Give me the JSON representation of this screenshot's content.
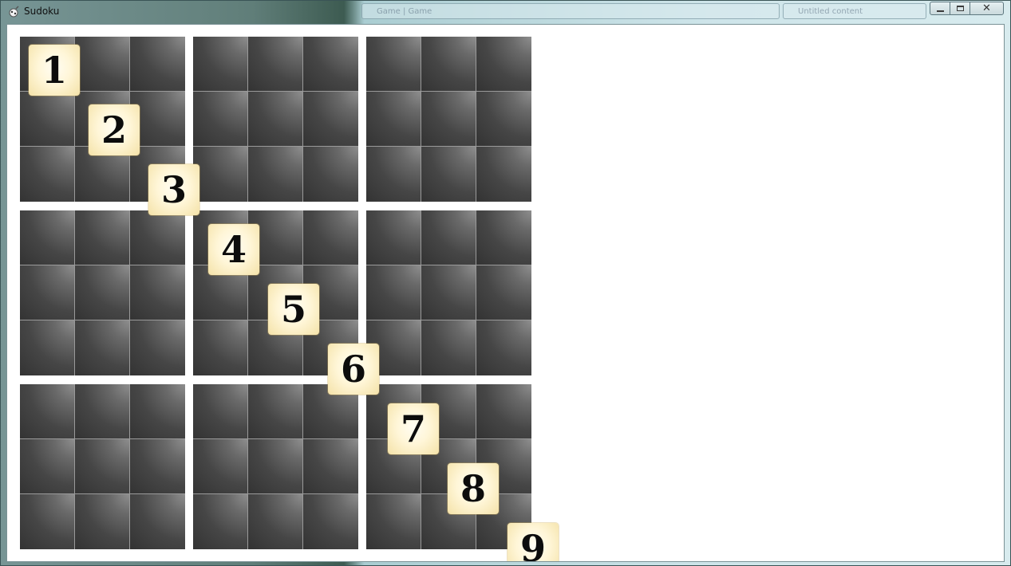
{
  "window": {
    "title": "Sudoku",
    "app_icon": "sudoku-app-icon",
    "background_tabs": [
      "Game | Game",
      "Untitled content"
    ],
    "controls": {
      "minimize": "minimize-icon",
      "maximize": "maximize-icon",
      "close": "close-icon"
    }
  },
  "board": {
    "cell_color": "#404040",
    "grid_line_color": "#9a9a9a",
    "tile_color": "#fff6d8",
    "tiles": [
      {
        "label": "1",
        "row": 1,
        "col": 1
      },
      {
        "label": "2",
        "row": 2,
        "col": 2
      },
      {
        "label": "3",
        "row": 3,
        "col": 3
      },
      {
        "label": "4",
        "row": 4,
        "col": 4
      },
      {
        "label": "5",
        "row": 5,
        "col": 5
      },
      {
        "label": "6",
        "row": 6,
        "col": 6
      },
      {
        "label": "7",
        "row": 7,
        "col": 7
      },
      {
        "label": "8",
        "row": 8,
        "col": 8
      },
      {
        "label": "9",
        "row": 9,
        "col": 9
      }
    ]
  }
}
